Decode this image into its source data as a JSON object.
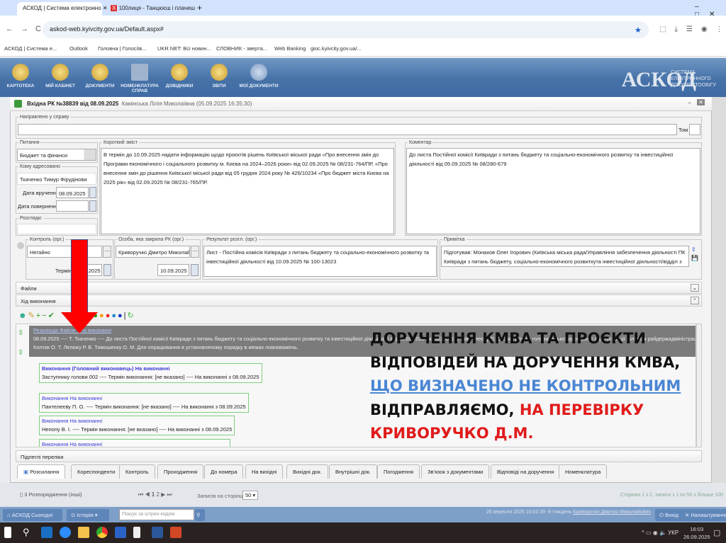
{
  "browser": {
    "tabs": [
      {
        "label": "АСКОД | Система електронно"
      },
      {
        "label": "100лиця - Танцюєш і плачеш"
      }
    ],
    "url": "askod-web.kyivcity.gov.ua/Default.aspx#",
    "bookmarks": [
      "АСКОД | Система е...",
      "Outlook",
      "Головна | Голосіїв...",
      "UKR.NET: Всі новин...",
      "СЛОВНИК - зверта...",
      "Web Banking",
      "gioc.kyivcity.gov.ua/..."
    ]
  },
  "app": {
    "nav": [
      "КАРТОТЕКА",
      "МІЙ КАБІНЕТ",
      "ДОКУМЕНТИ",
      "НОМЕНКЛАТУРА СПРАВ",
      "ДОВІДНИКИ",
      "ЗВІТИ",
      "МОЇ ДОКУМЕНТИ"
    ],
    "logo": "АСКОД",
    "logo_sub": "СИСТЕМА ЕЛЕКТРОННОГО ДОКУМЕНТООБІГУ"
  },
  "window": {
    "title": "Вхідна РК №38839 від 08.09.2025",
    "author": "Камінська Лілія Миколаївна (05.09.2025 16:35:30)"
  },
  "form": {
    "napravleno_label": "Направлено у справу",
    "tom_label": "Том",
    "pytannia_label": "Питання",
    "pytannia": "Бюджет та фінанси",
    "komu_label": "Кому адресовано",
    "komu": "Ткаченко Тимур Фірудінови",
    "data_vruch_label": "Дата вручення:",
    "data_vruch": "08.09.2025",
    "data_pov_label": "Дата повернення:",
    "rozgliad_label": "Розгляди:",
    "zmist_label": "Короткий зміст",
    "zmist": "В термін до 10.09.2025 надати інформацію щодо проєктів рішень Київської міської ради «Про внесення змін до Програми економічного і соціального розвитку м. Києва на 2024–2026 роки» від 02.09.2025  № 08/231-764/ПР, «Про внесення змін до рішення Київської міської ради від 05 грудня 2024 року № 426/10234 «Про бюджет міста Києва на 2025 рік» від 02.09.2025  № 08/231-765/ПР.",
    "komentar_label": "Коментар",
    "komentar": "До листа Постійної комісії Київради з питань бюджету та соціально-економічного розвитку та інвестиційної діяльності від 05.09.2025 № 08/280-679",
    "kontrol_label": "Контроль (орг.)",
    "kontrol": "Негайно",
    "termin_label": "Термін",
    "termin": "10.09.2025",
    "osoba_label": "Особа, яка закрила РК (орг.)",
    "osoba": "Криворучко Дмитро Миколайо",
    "osoba_date": "10.09.2025",
    "rezultat_label": "Результат розгл. (орг.)",
    "rezultat": "Лист - Постійна комісія Київради з питань бюджету та соціально-економічного розвитку та інвестиційної діяльності  від 10.09.2025 № 100-13023",
    "prymitka_label": "Примітка",
    "prymitka": "Підготував: Монахов Олег Ігорович (Київська міська рада/Управління забезпечення діяльності ПК Київради з питань бюджету, соціально-економічного розвиткута інвестиційної діяльності/відділ з питань"
  },
  "sections": {
    "files": "Файли",
    "progress": "Хід виконання",
    "subordinate": "Підлеглі переліки"
  },
  "tree": {
    "root_title": "Резолюція Файли - На виконанні",
    "root_line1": "08.09.2025 ---- Т. Ткаченко ---- До листа Постійної комісії Київради з питань бюджету та соціально-економічного розвитку та інвестиційної діяльності від 05.09.2025 № 08/280-679 Пантелеєву П. О. Заступнику голови міської державної адміністрації головам райдержадміністрацій",
    "root_line2": "Колтик О. Т. Лелюку Р. В. Тимошенку О. М. Для опрацювання в установленому порядку в межах повноважень.",
    "nodes": [
      {
        "title": "Виконання (Головний виконавець) На виконанні",
        "text": "Заступнику голови 002 ---- Термін виконання: [не вказано] ---- На виконанні з 08.09.2025"
      },
      {
        "title": "Виконання На виконанні",
        "text": "Пантелеєву П. О. ---- Термін виконання: [не вказано] ---- На виконанні з 08.09.2025"
      },
      {
        "title": "Виконання На виконанні",
        "text": "Непопу В. І. ---- Термін виконання: [не вказано] ---- На виконанні з 08.09.2025"
      },
      {
        "title": "Виконання На виконанні"
      }
    ]
  },
  "tabs": [
    "Розсилання",
    "Кореспонденти",
    "Контроль",
    "Проходження",
    "До номера",
    "На вихідні",
    "Вихідні док.",
    "Внутрішні док.",
    "Погодження",
    "Зв'язок з документами",
    "Відповіді на доручення",
    "Номенклатура"
  ],
  "overlay": {
    "line1": "ДОРУЧЕННЯ КМВА ТА ПРОЄКТИ",
    "line2": "ВІДПОВІДЕЙ НА ДОРУЧЕННЯ КМВА,",
    "line3": "ЩО ВИЗНАЧЕНО НЕ КОНТРОЛЬНИМ",
    "line4": "ВІДПРАВЛЯЄМО, ",
    "line4b": "НА ПЕРЕВІРКУ",
    "line5": "КРИВОРУЧКО Д.М."
  },
  "pagination": {
    "folder": "3 Розпорядження (інші)",
    "pages": [
      "1",
      "2"
    ],
    "per_page_label": "Записів на сторінці",
    "per_page": "50",
    "summary": "Сторінка 1 з 2, записи з 1 по 50 з більше 100"
  },
  "footer": {
    "today": "АСКОД Сьогодні",
    "history": "Історія",
    "search_placeholder": "Пошук за штрих-кодом",
    "status": "26 вересня 2025 16:03 39 -й тиждень",
    "user": "Криворучко Дмитро Миколайович",
    "exit": "Вихід",
    "settings": "Налаштування"
  },
  "taskbar": {
    "lang": "УКР",
    "time": "16:03",
    "date": "26.09.2025"
  }
}
